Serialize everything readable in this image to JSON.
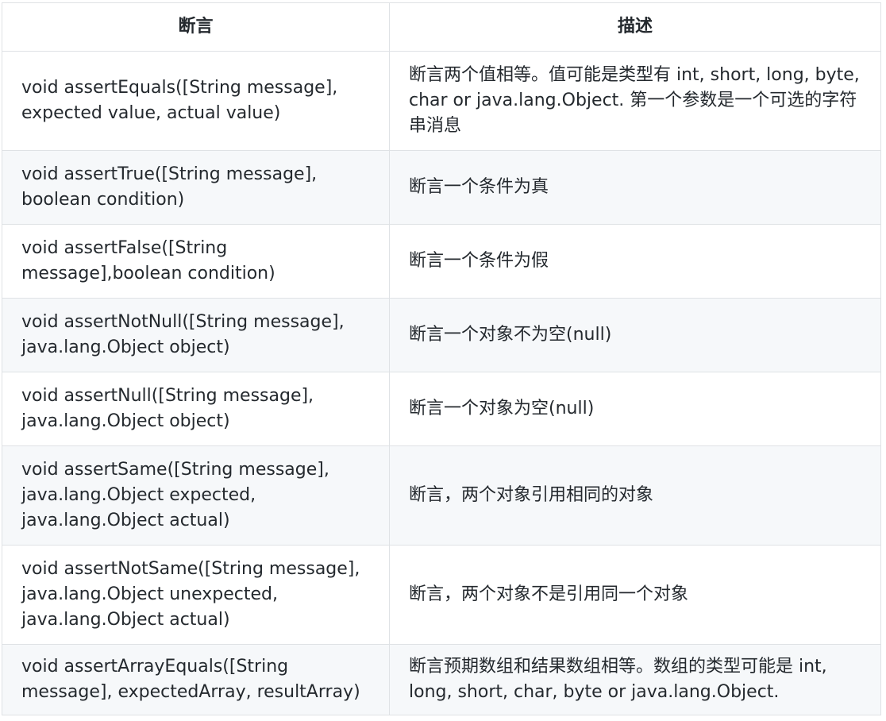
{
  "header": {
    "col1": "断言",
    "col2": "描述"
  },
  "rows": [
    {
      "method": "void assertEquals([String message], expected value, actual value)",
      "description": "断言两个值相等。值可能是类型有 int, short, long, byte, char or java.lang.Object. 第一个参数是一个可选的字符串消息"
    },
    {
      "method": "void assertTrue([String message], boolean condition)",
      "description": "断言一个条件为真"
    },
    {
      "method": "void assertFalse([String message],boolean condition)",
      "description": "断言一个条件为假"
    },
    {
      "method": "void assertNotNull([String message], java.lang.Object object)",
      "description": "断言一个对象不为空(null)"
    },
    {
      "method": "void assertNull([String message], java.lang.Object object)",
      "description": "断言一个对象为空(null)"
    },
    {
      "method": "void assertSame([String message], java.lang.Object expected, java.lang.Object actual)",
      "description": "断言，两个对象引用相同的对象"
    },
    {
      "method": "void assertNotSame([String message], java.lang.Object unexpected, java.lang.Object actual)",
      "description": "断言，两个对象不是引用同一个对象"
    },
    {
      "method": "void assertArrayEquals([String message], expectedArray, resultArray)",
      "description": "断言预期数组和结果数组相等。数组的类型可能是 int, long, short, char, byte or java.lang.Object."
    }
  ]
}
